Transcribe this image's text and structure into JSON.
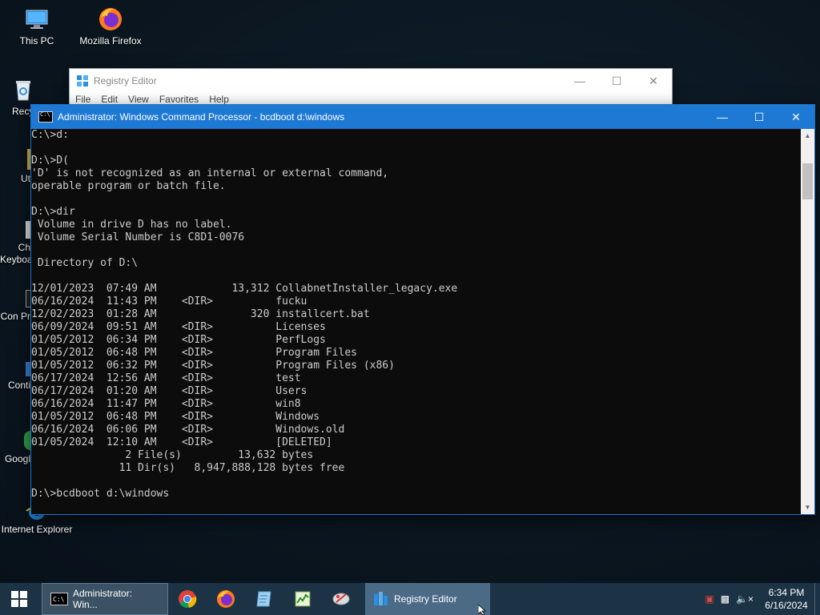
{
  "desktop": {
    "icons": [
      {
        "label": "This PC"
      },
      {
        "label": "Mozilla Firefox"
      },
      {
        "label": "Recy"
      },
      {
        "label": "Ut"
      },
      {
        "label": "Ch Keyboa"
      },
      {
        "label": "Con Pr"
      },
      {
        "label": "Conti"
      },
      {
        "label": "Googl"
      },
      {
        "label": "Internet Explorer"
      }
    ]
  },
  "registry_window": {
    "title": "Registry Editor",
    "menu": [
      "File",
      "Edit",
      "View",
      "Favorites",
      "Help"
    ]
  },
  "cmd_window": {
    "title": "Administrator: Windows Command Processor - bcdboot  d:\\windows",
    "lines": [
      "C:\\>d:",
      "",
      "D:\\>D(",
      "'D' is not recognized as an internal or external command,",
      "operable program or batch file.",
      "",
      "D:\\>dir",
      " Volume in drive D has no label.",
      " Volume Serial Number is C8D1-0076",
      "",
      " Directory of D:\\",
      "",
      "12/01/2023  07:49 AM            13,312 CollabnetInstaller_legacy.exe",
      "06/16/2024  11:43 PM    <DIR>          fucku",
      "12/02/2023  01:28 AM               320 installcert.bat",
      "06/09/2024  09:51 AM    <DIR>          Licenses",
      "01/05/2012  06:34 PM    <DIR>          PerfLogs",
      "01/05/2012  06:48 PM    <DIR>          Program Files",
      "01/05/2012  06:32 PM    <DIR>          Program Files (x86)",
      "06/17/2024  12:56 AM    <DIR>          test",
      "06/17/2024  01:20 AM    <DIR>          Users",
      "06/16/2024  11:47 PM    <DIR>          win8",
      "01/05/2012  06:48 PM    <DIR>          Windows",
      "06/16/2024  06:06 PM    <DIR>          Windows.old",
      "01/05/2024  12:10 AM    <DIR>          [DELETED]",
      "               2 File(s)         13,632 bytes",
      "              11 Dir(s)   8,947,888,128 bytes free",
      "",
      "D:\\>bcdboot d:\\windows"
    ]
  },
  "taskbar": {
    "cmd_task_label": "Administrator: Win...",
    "reg_task_label": "Registry Editor",
    "time": "6:34 PM",
    "date": "6/16/2024"
  },
  "colors": {
    "cmd_title_bar": "#1e79d4",
    "console_bg": "#0c0c0c",
    "console_text": "#cccccc",
    "taskbar": "#1c3345"
  }
}
